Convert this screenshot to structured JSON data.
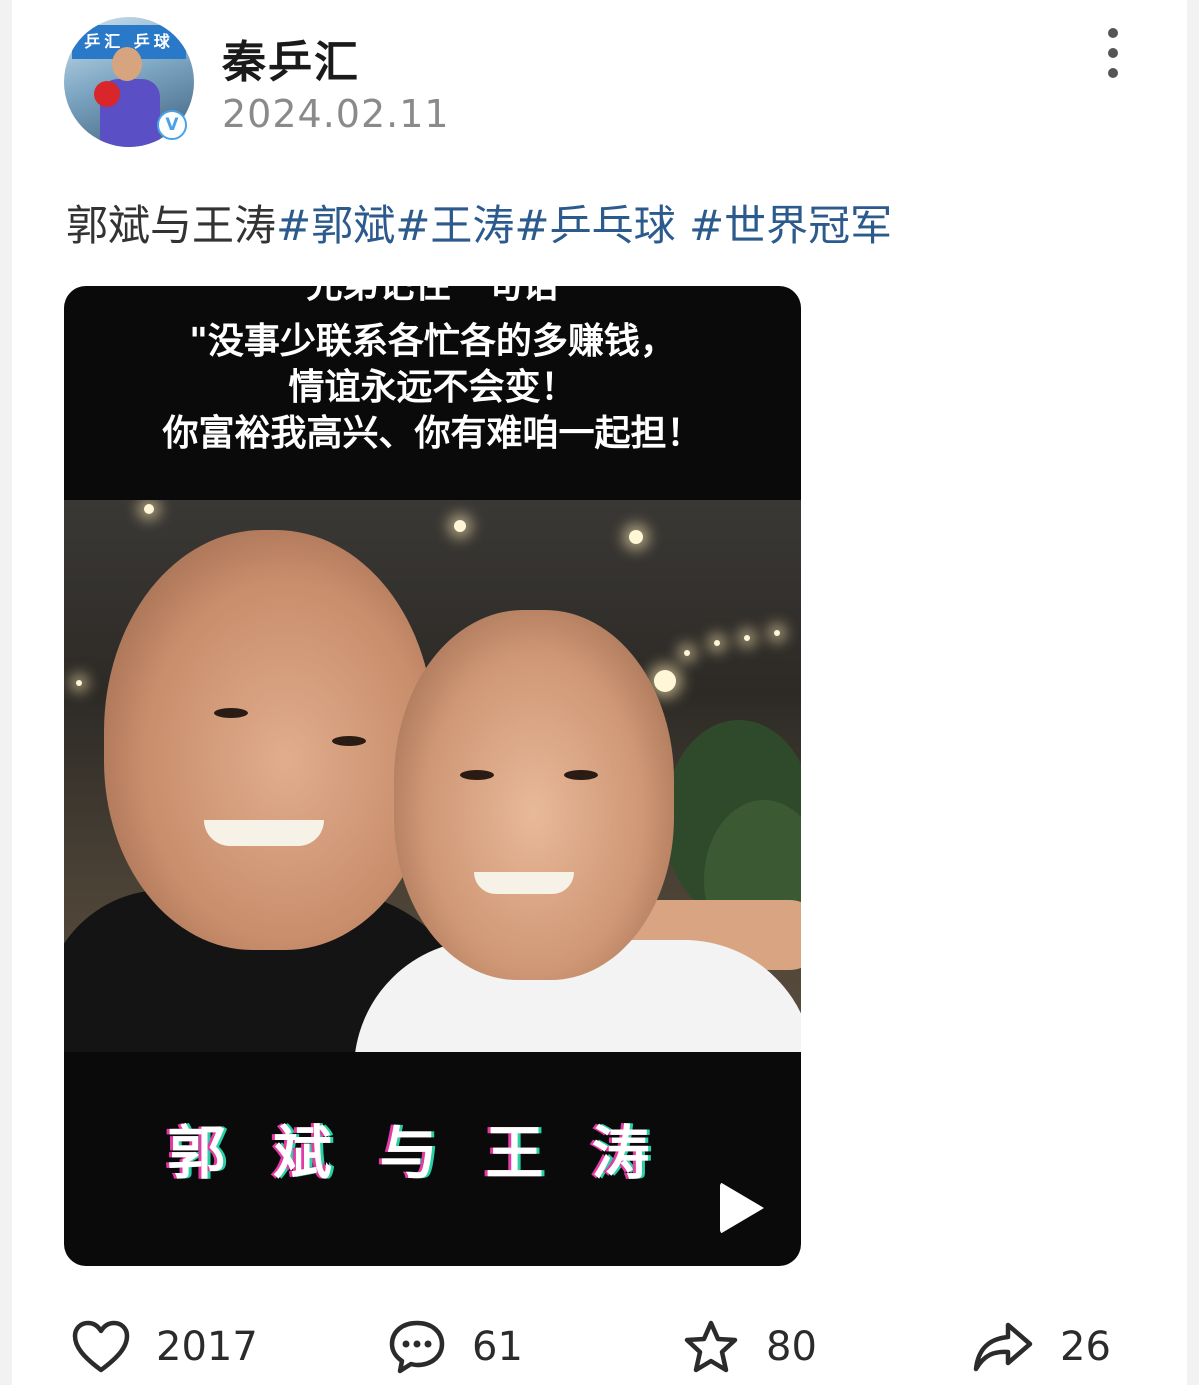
{
  "post": {
    "username": "秦乒汇",
    "date": "2024.02.11",
    "text": "郭斌与王涛",
    "hashtags": [
      "#郭斌",
      "#王涛",
      "#乒乓球 ",
      "#世界冠军"
    ],
    "verified_mark": "V",
    "avatar_sign": "乒汇 乒球"
  },
  "video": {
    "caption_top": [
      "兄弟记住一句话",
      "\"没事少联系各忙各的多赚钱，",
      "情谊永远不会变！",
      "你富裕我高兴、你有难咱一起担！"
    ],
    "caption_bottom": "郭斌与王涛"
  },
  "actions": {
    "likes": "2017",
    "comments": "61",
    "favorites": "80",
    "shares": "26"
  },
  "icons": {
    "like": "heart-icon",
    "comment": "comment-bubble-icon",
    "favorite": "star-icon",
    "share": "share-arrow-icon",
    "more": "more-vertical-icon",
    "play": "play-icon"
  },
  "colors": {
    "hashtag": "#2c5a8c",
    "text": "#333333",
    "date": "#8a8a8a",
    "verified": "#4aa3e8"
  }
}
